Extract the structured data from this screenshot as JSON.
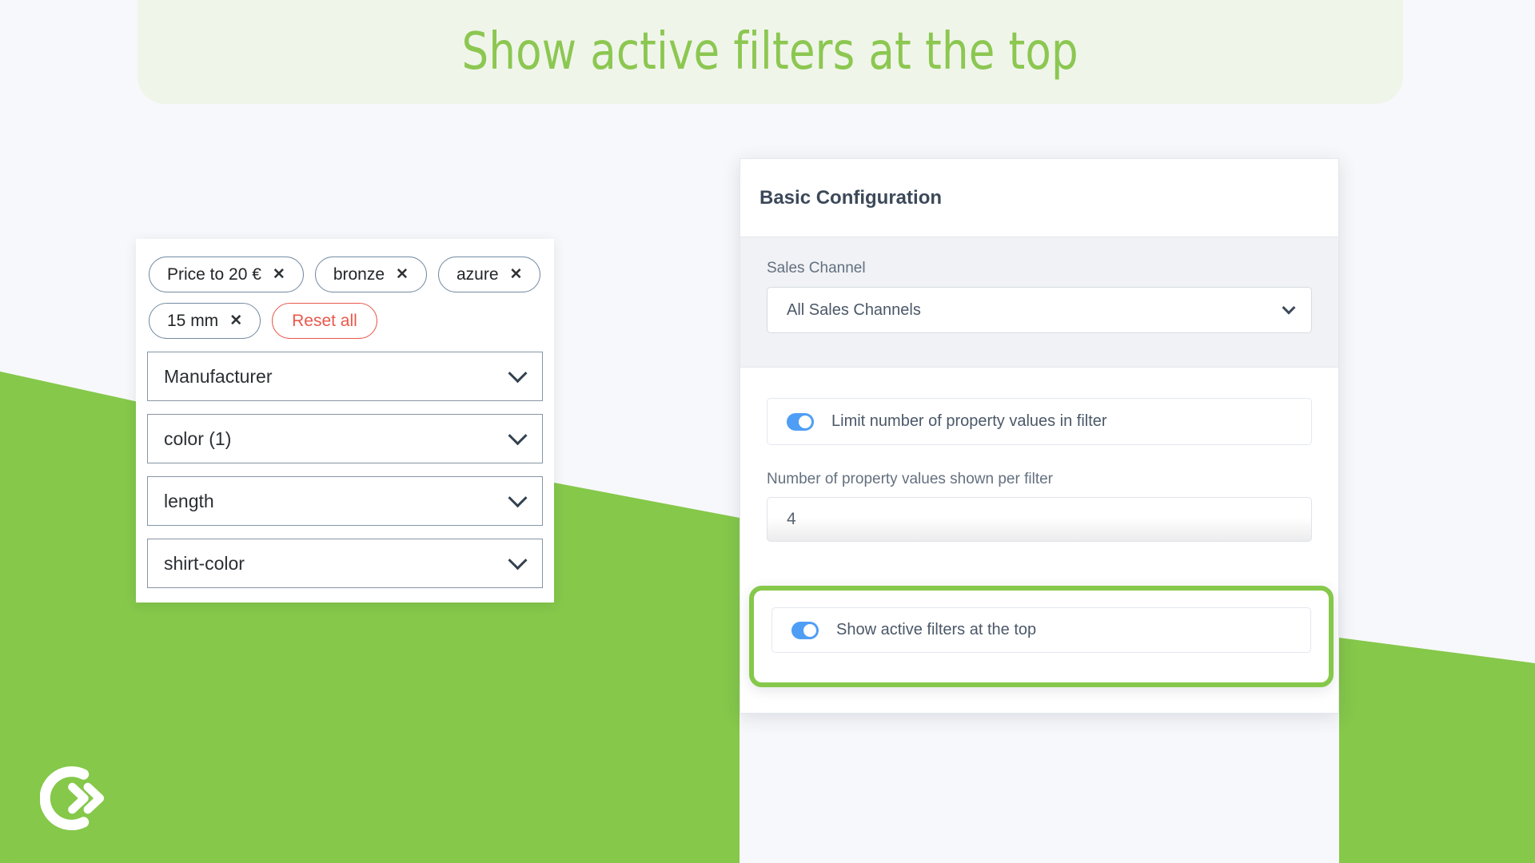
{
  "page": {
    "title": "Show active filters at the top",
    "background_color": "#f7f8fb",
    "accent_green": "#85c84a",
    "banner_background": "#f0f5ea"
  },
  "filter_panel": {
    "name": "storefront-filter-preview",
    "pills": [
      {
        "label": "Price to 20 €",
        "remove_icon": "✕",
        "type": "filter-chip"
      },
      {
        "label": "bronze",
        "remove_icon": "✕",
        "type": "filter-chip"
      },
      {
        "label": "azure",
        "remove_icon": "✕",
        "type": "filter-chip"
      },
      {
        "label": "15 mm",
        "remove_icon": "✕",
        "type": "filter-chip"
      }
    ],
    "reset": {
      "label": "Reset all",
      "color": "#e8584b"
    },
    "accordions": [
      {
        "label": "Manufacturer",
        "icon": "chevron-down-icon"
      },
      {
        "label": "color (1)",
        "icon": "chevron-down-icon"
      },
      {
        "label": "length",
        "icon": "chevron-down-icon"
      },
      {
        "label": "shirt-color",
        "icon": "chevron-down-icon"
      }
    ]
  },
  "config_card": {
    "header_title": "Basic Configuration",
    "sales_channel": {
      "label": "Sales Channel",
      "value": "All Sales Channels",
      "icon": "chevron-down-icon"
    },
    "limit_toggle": {
      "label": "Limit number of property values in filter",
      "state": "on",
      "color": "#4f9ef6"
    },
    "number_field": {
      "label": "Number of property values shown per filter",
      "value": "4"
    }
  },
  "highlight": {
    "toggle": {
      "label": "Show active filters at the top",
      "state": "on",
      "color": "#4f9ef6"
    },
    "border_color": "#85c84a"
  },
  "logo": {
    "name": "brand-logo",
    "description": "white circular C with double chevron"
  }
}
